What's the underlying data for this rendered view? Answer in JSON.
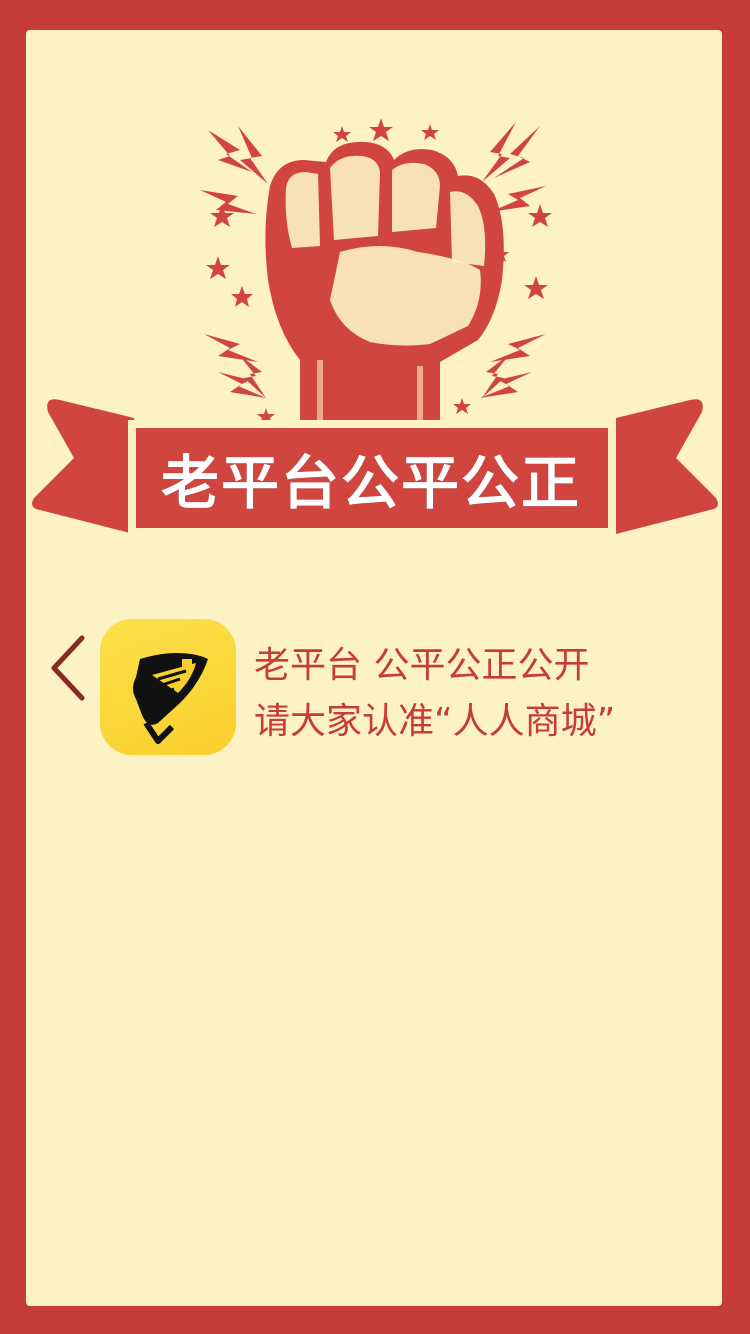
{
  "hero": {
    "banner_title": "老平台公平公正"
  },
  "message": {
    "line1": "老平台 公平公正公开",
    "line2": "请大家认准“人人商城”"
  },
  "icons": {
    "back": "chevron-left-icon",
    "app": "fish-app-icon",
    "fist": "raised-fist-icon"
  },
  "colors": {
    "red": "#c63c36",
    "cream": "#fdf2c4",
    "yellow": "#f9cf2c"
  }
}
